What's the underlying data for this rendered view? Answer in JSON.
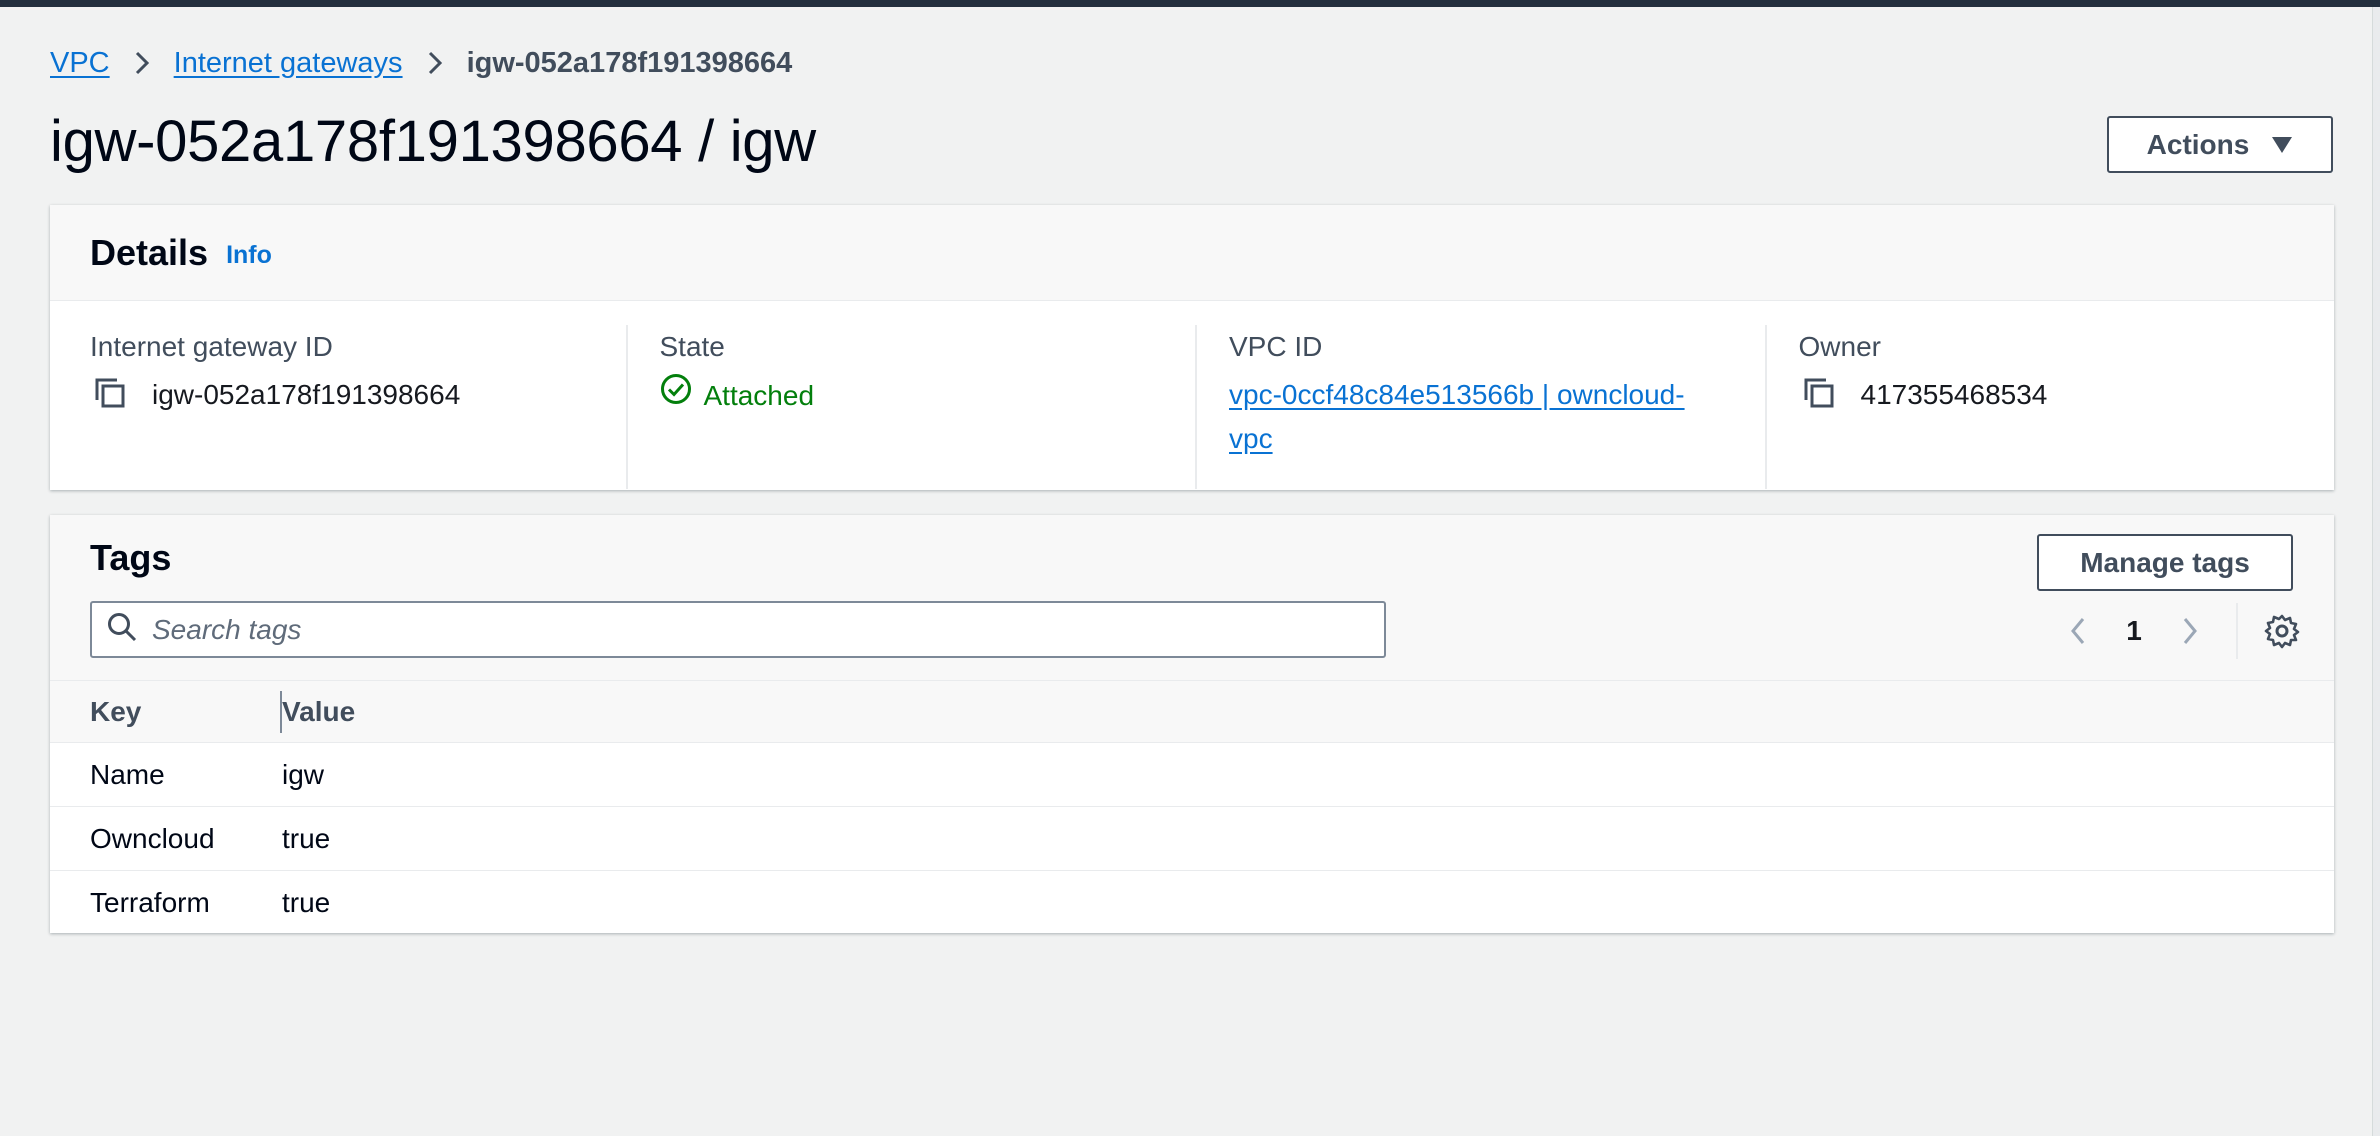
{
  "breadcrumb": {
    "items": [
      "VPC",
      "Internet gateways"
    ],
    "current": "igw-052a178f191398664"
  },
  "page": {
    "title": "igw-052a178f191398664 / igw",
    "actions_label": "Actions"
  },
  "details": {
    "heading": "Details",
    "info_label": "Info",
    "fields": {
      "gateway_id_label": "Internet gateway ID",
      "gateway_id_value": "igw-052a178f191398664",
      "state_label": "State",
      "state_value": "Attached",
      "vpc_id_label": "VPC ID",
      "vpc_id_value": "vpc-0ccf48c84e513566b | owncloud-vpc",
      "owner_label": "Owner",
      "owner_value": "417355468534"
    }
  },
  "tags": {
    "heading": "Tags",
    "manage_label": "Manage tags",
    "search_placeholder": "Search tags",
    "page": "1",
    "columns": [
      "Key",
      "Value"
    ],
    "rows": [
      {
        "key": "Name",
        "value": "igw"
      },
      {
        "key": "Owncloud",
        "value": "true"
      },
      {
        "key": "Terraform",
        "value": "true"
      }
    ]
  },
  "colors": {
    "link": "#0972d3",
    "success": "#037f0c",
    "topbar": "#232f3e"
  },
  "icons": [
    "chevron-right-icon",
    "caret-down-icon",
    "copy-icon",
    "status-success-icon",
    "search-icon",
    "angle-left-icon",
    "angle-right-icon",
    "settings-gear-icon"
  ]
}
